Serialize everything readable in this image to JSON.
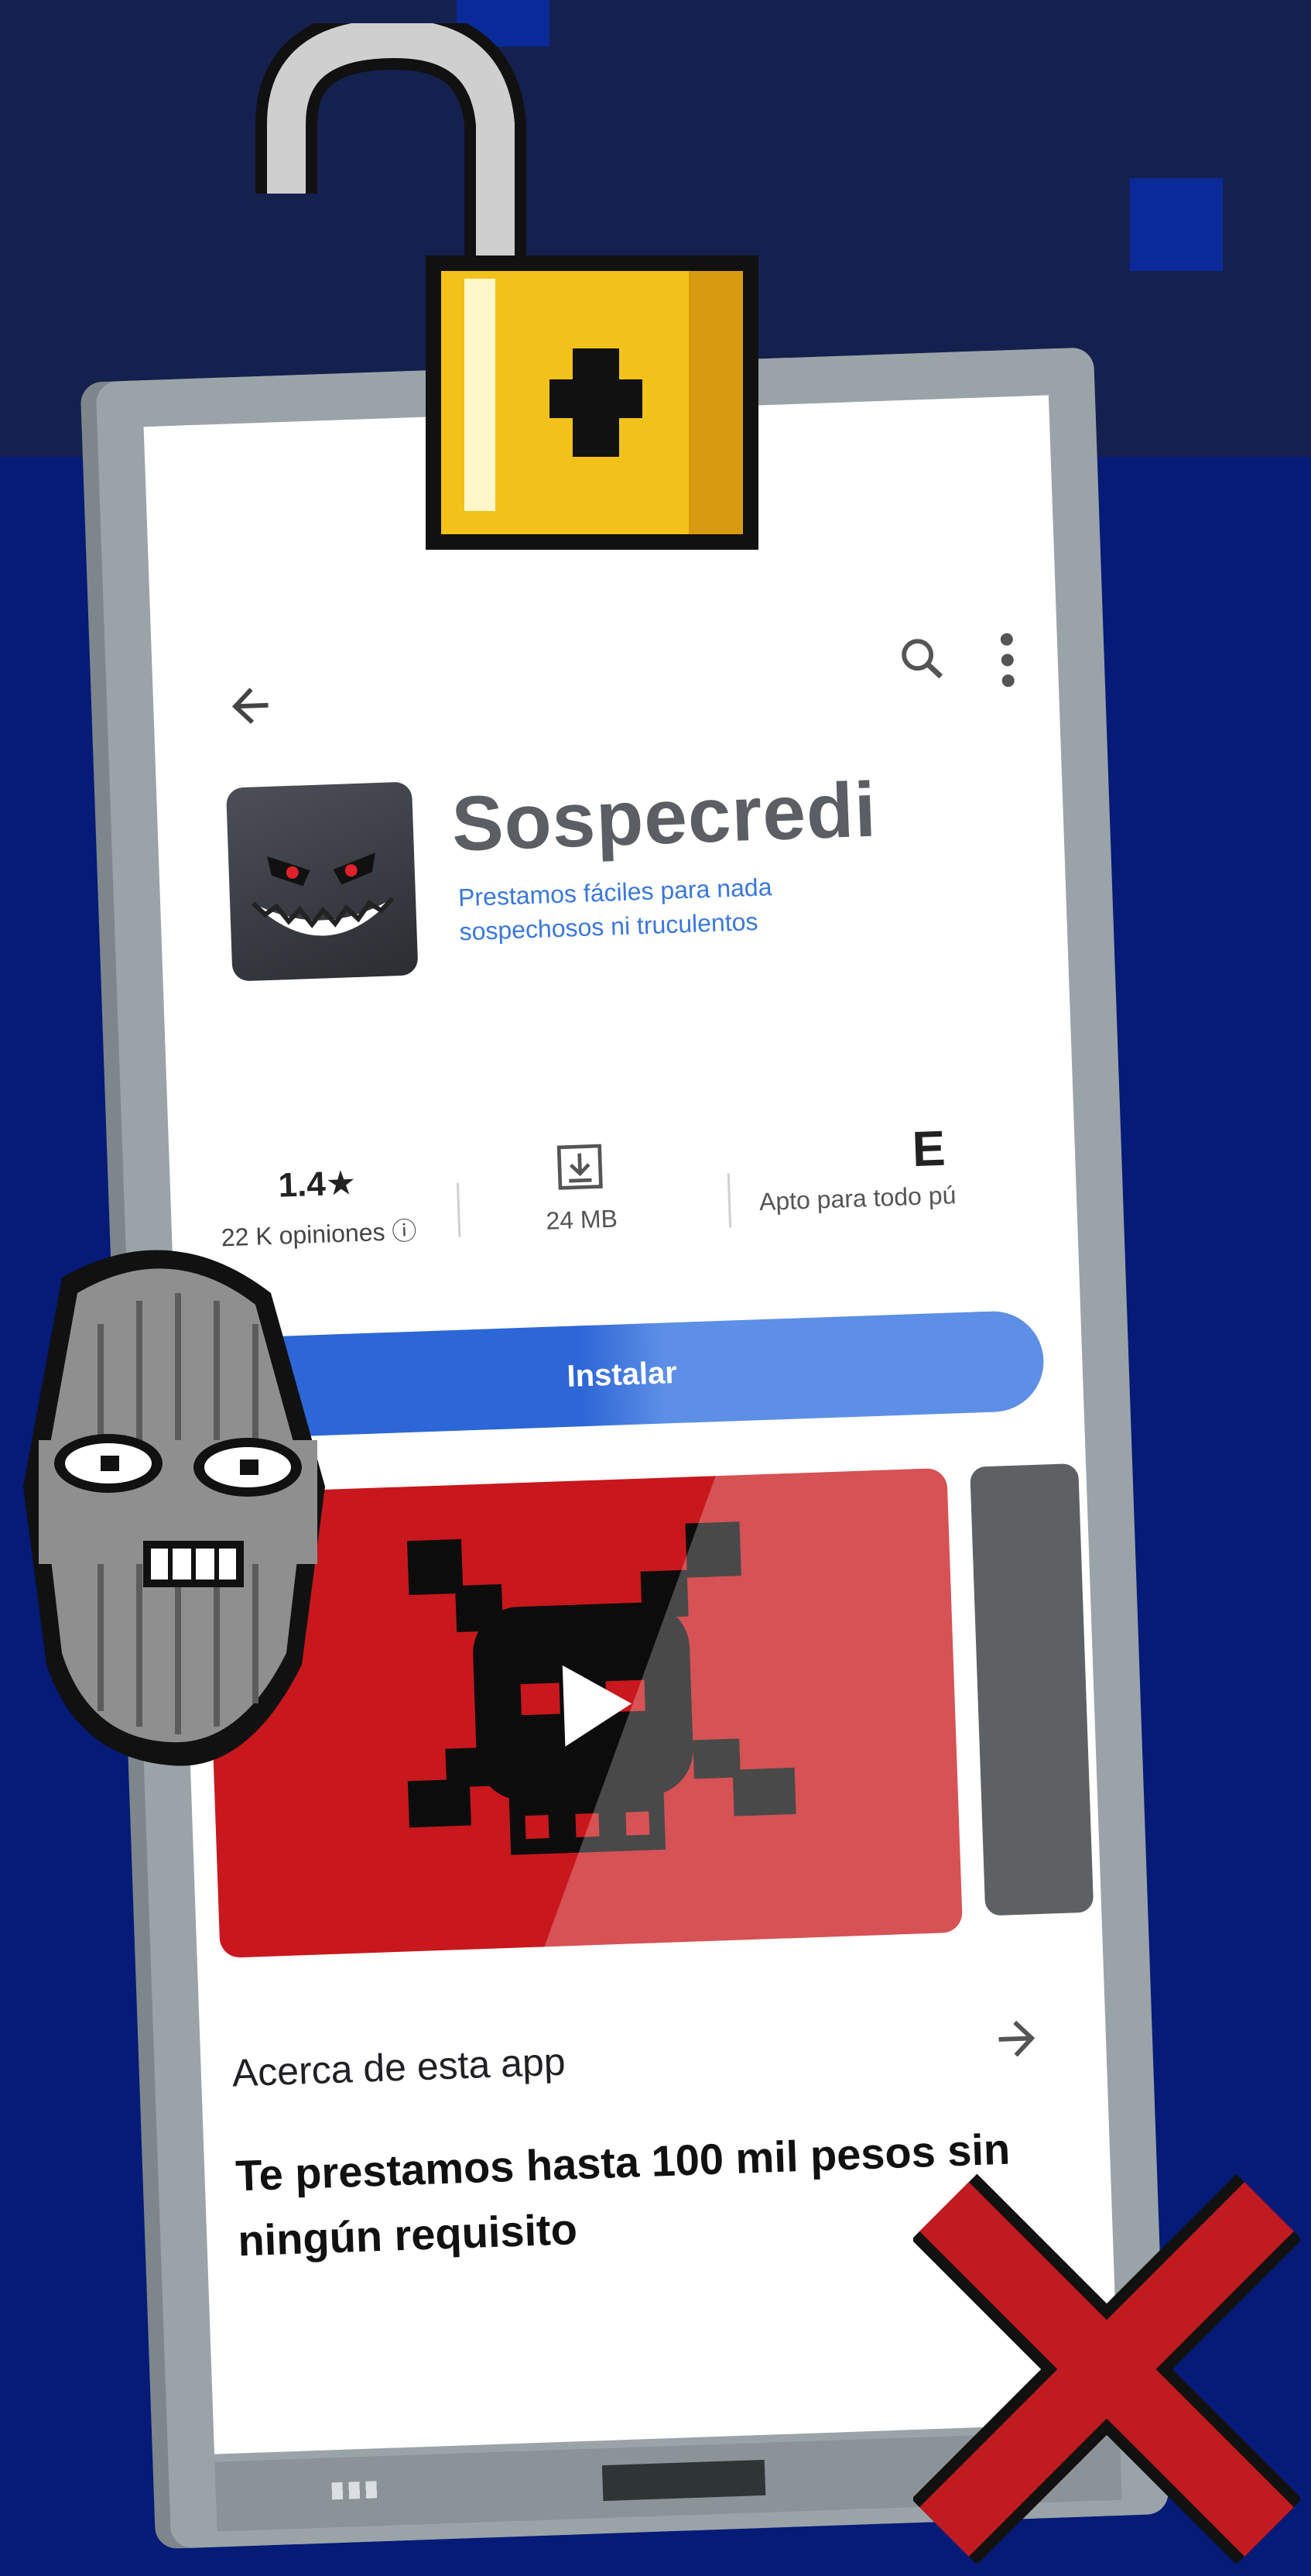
{
  "app": {
    "name": "Sospecredi",
    "tagline": "Prestamos fáciles para nada sospechosos ni truculentos"
  },
  "stats": {
    "rating": "1.4★",
    "reviews": "22 K opiniones ⓘ",
    "size": "24 MB",
    "age_icon_letter": "E",
    "age_label": "Apto para todo pú"
  },
  "install_label": "Instalar",
  "about": {
    "title": "Acerca de esta app",
    "description": "Te prestamos hasta 100 mil pesos sin ningún requisito"
  },
  "icons": [
    "back-arrow-icon",
    "search-icon",
    "more-vert-icon",
    "download-icon",
    "play-icon",
    "arrow-right-icon",
    "padlock-icon",
    "ski-mask-icon",
    "skull-crossbones-icon",
    "red-x-icon"
  ],
  "colors": {
    "background_top": "#14214f",
    "background": "#061a78",
    "accent_blue": "#2d66d6",
    "video_red": "#c8181d",
    "padlock_gold": "#f2c21a"
  }
}
